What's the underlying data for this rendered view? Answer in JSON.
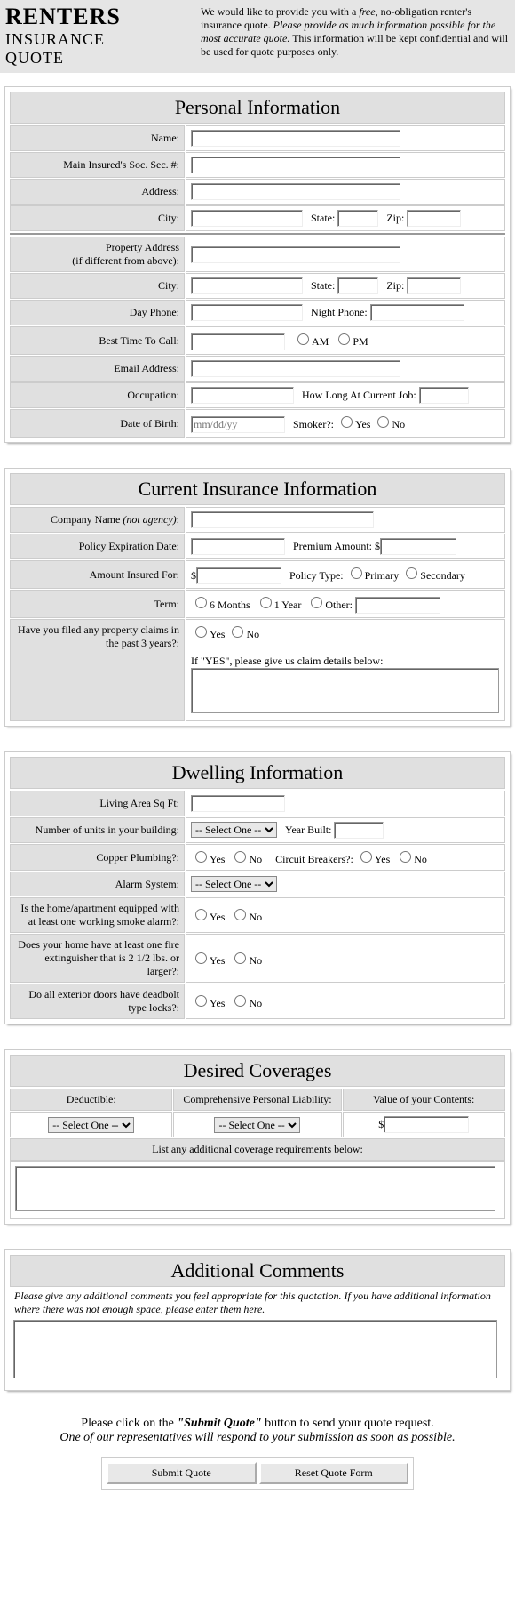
{
  "header": {
    "t1": "RENTERS",
    "t2a": "INSURANCE",
    "t2b": "QUOTE",
    "intro_a": "We would like to provide you with a ",
    "intro_free": "free",
    "intro_b": ", no-obligation renter's insurance quote. ",
    "intro_c": "Please provide as much information possible for the most accurate quote.",
    "intro_d": " This information will be kept confidential and will be used for quote purposes only."
  },
  "pi": {
    "title": "Personal Information",
    "name": "Name:",
    "ssn": "Main Insured's Soc. Sec. #:",
    "addr": "Address:",
    "city": "City:",
    "state": "State:",
    "zip": "Zip:",
    "prop1": "Property Address",
    "prop2": "(if different from above):",
    "day": "Day Phone:",
    "night": "Night Phone:",
    "best": "Best Time To Call:",
    "am": "AM",
    "pm": "PM",
    "email": "Email Address:",
    "occ": "Occupation:",
    "howlong": "How Long At Current Job:",
    "dob": "Date of Birth:",
    "dobph": "mm/dd/yy",
    "smoker": "Smoker?:",
    "yes": "Yes",
    "no": "No"
  },
  "ci": {
    "title": "Current Insurance Information",
    "comp_a": "Company Name ",
    "comp_b": "(not agency)",
    "comp_c": ":",
    "exp": "Policy Expiration Date:",
    "prem": "Premium Amount: $",
    "amt": "Amount Insured For:",
    "dol": "$",
    "ptype": "Policy Type:",
    "primary": "Primary",
    "secondary": "Secondary",
    "term": "Term:",
    "m6": "6 Months",
    "y1": "1 Year",
    "other": "Other:",
    "claims": "Have you filed any property claims in the past 3 years?:",
    "yes": "Yes",
    "no": "No",
    "ifyes": "If \"YES\", please give us claim details below:"
  },
  "dw": {
    "title": "Dwelling Information",
    "sqft": "Living Area Sq Ft:",
    "units": "Number of units in your building:",
    "sel": "-- Select One --",
    "yb": "Year Built:",
    "copper": "Copper Plumbing?:",
    "cb": "Circuit Breakers?:",
    "alarm": "Alarm System:",
    "smoke": "Is the home/apartment equipped with at least one working smoke alarm?:",
    "ext": "Does your home have at least one fire extinguisher that is 2 1/2 lbs. or larger?:",
    "dead": "Do all exterior doors have deadbolt type locks?:",
    "yes": "Yes",
    "no": "No"
  },
  "dc": {
    "title": "Desired Coverages",
    "ded": "Deductible:",
    "cpl": "Comprehensive Personal Liability:",
    "voc": "Value of your Contents:",
    "sel": "-- Select One --",
    "dol": "$",
    "list": "List any additional coverage requirements below:"
  },
  "ac": {
    "title": "Additional Comments",
    "note": "Please give any additional comments you feel appropriate for this quotation. If you have additional information where there was not enough space, please enter them here."
  },
  "sub": {
    "a": "Please click on the ",
    "q": "\"Submit Quote\"",
    "b": " button to send your quote request.",
    "c": "One of our representatives will respond to your submission as soon as possible.",
    "submit": "Submit Quote",
    "reset": "Reset Quote Form"
  }
}
